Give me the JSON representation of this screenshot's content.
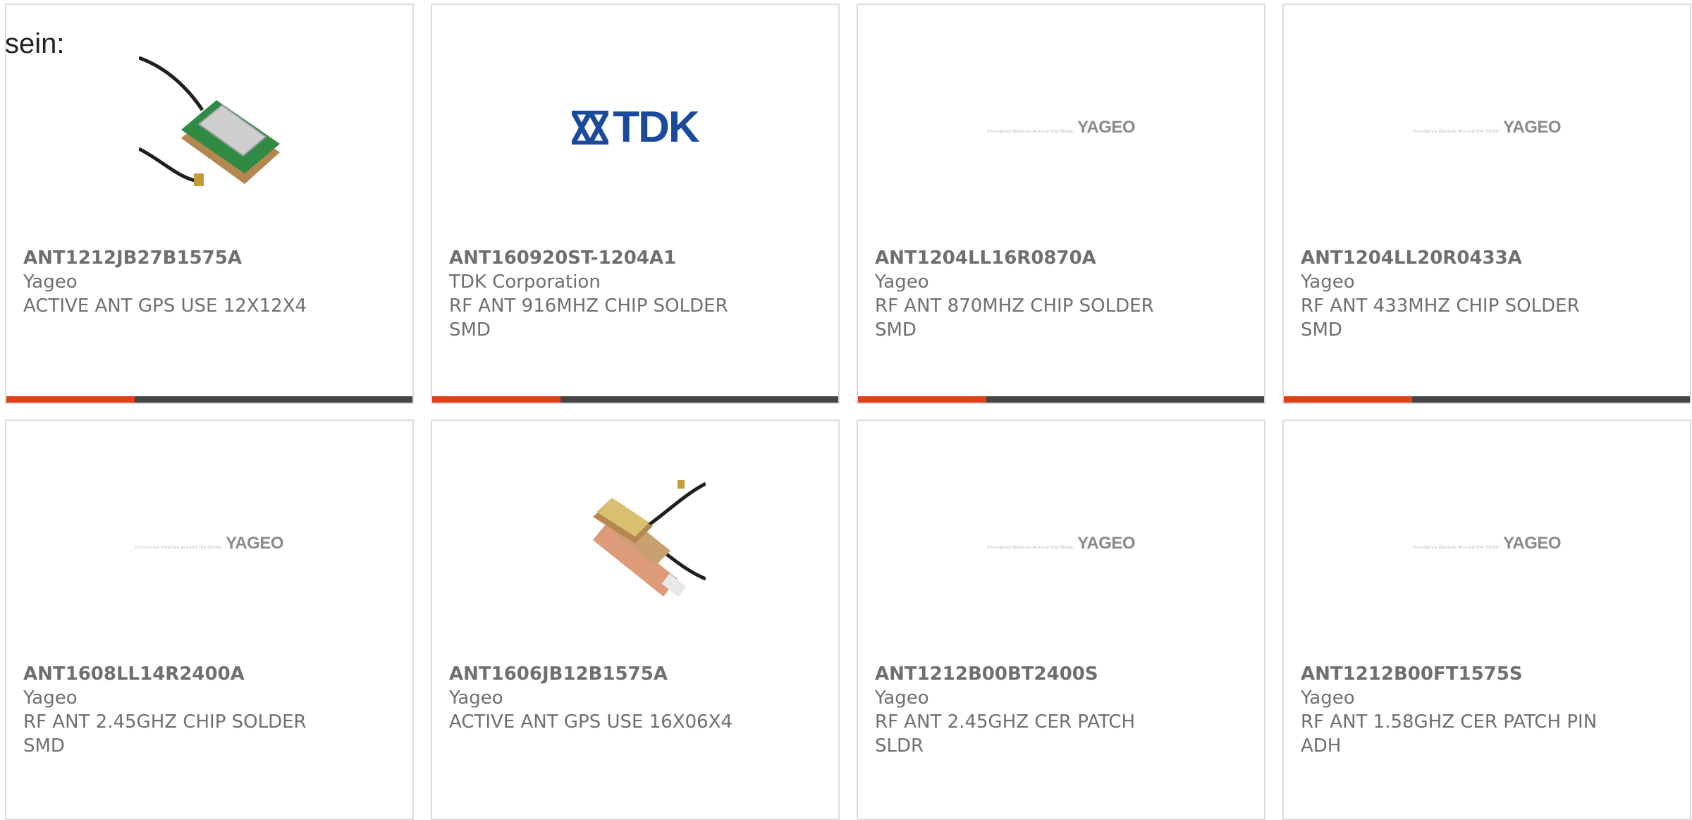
{
  "intro_text": "sein:",
  "colors": {
    "accent": "#e0401c",
    "bar": "#454545",
    "text": "#6f6f6f",
    "tdk_blue": "#1a4a9c"
  },
  "logos": {
    "yageo_word": "YAGEO",
    "yageo_tagline": "Innovative Devices Around the Globe",
    "tdk_word": "TDK"
  },
  "products": [
    {
      "part_number": "ANT1212JB27B1575A",
      "manufacturer": "Yageo",
      "description": "ACTIVE ANT GPS USE 12X12X4",
      "image": "gps-patch-antenna-photo"
    },
    {
      "part_number": "ANT160920ST-1204A1",
      "manufacturer": "TDK Corporation",
      "description": "RF ANT 916MHZ CHIP SOLDER SMD",
      "image": "tdk-logo"
    },
    {
      "part_number": "ANT1204LL16R0870A",
      "manufacturer": "Yageo",
      "description": "RF ANT 870MHZ CHIP SOLDER SMD",
      "image": "yageo-logo"
    },
    {
      "part_number": "ANT1204LL20R0433A",
      "manufacturer": "Yageo",
      "description": "RF ANT 433MHZ CHIP SOLDER SMD",
      "image": "yageo-logo"
    },
    {
      "part_number": "ANT1608LL14R2400A",
      "manufacturer": "Yageo",
      "description": "RF ANT 2.45GHZ CHIP SOLDER SMD",
      "image": "yageo-logo"
    },
    {
      "part_number": "ANT1606JB12B1575A",
      "manufacturer": "Yageo",
      "description": "ACTIVE ANT GPS USE 16X06X4",
      "image": "gps-flex-antenna-photo"
    },
    {
      "part_number": "ANT1212B00BT2400S",
      "manufacturer": "Yageo",
      "description": "RF ANT 2.45GHZ CER PATCH SLDR",
      "image": "yageo-logo"
    },
    {
      "part_number": "ANT1212B00FT1575S",
      "manufacturer": "Yageo",
      "description": "RF ANT 1.58GHZ CER PATCH PIN ADH",
      "image": "yageo-logo"
    }
  ]
}
